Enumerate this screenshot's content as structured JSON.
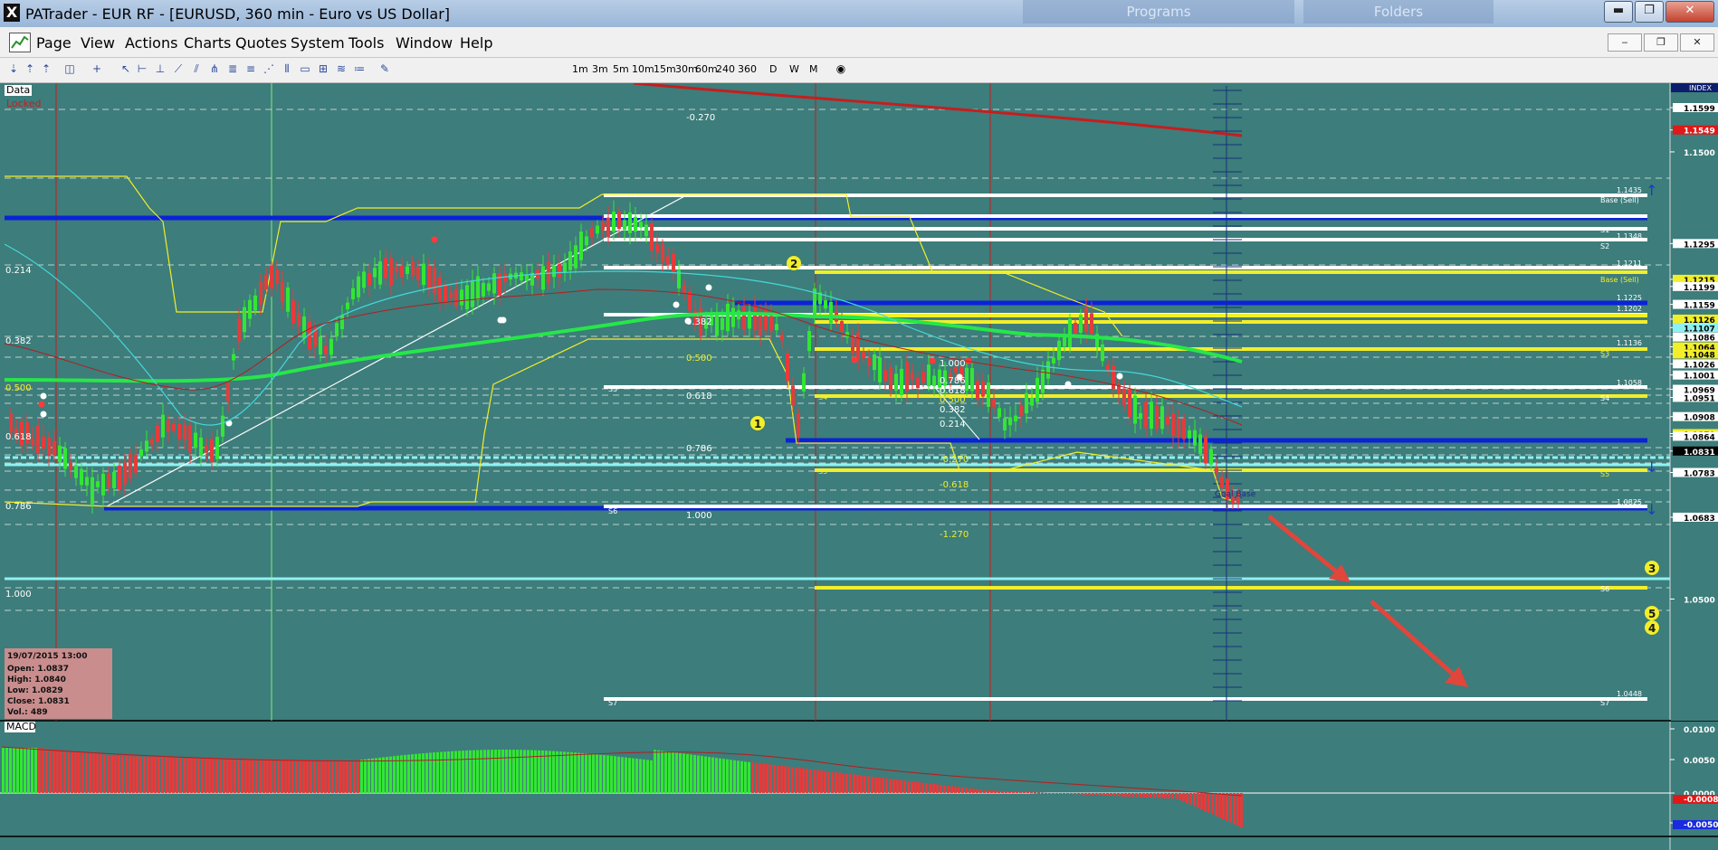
{
  "window": {
    "title": "PATrader - EUR RF - [EURUSD, 360 min - Euro vs US Dollar]",
    "app_icon": "X",
    "background_tabs": [
      "Programs",
      "Folders"
    ],
    "buttons": {
      "minimize": "▬",
      "maximize": "❐",
      "close": "✕"
    }
  },
  "menu": {
    "items": [
      "Page",
      "View",
      "Actions",
      "Charts",
      "Quotes",
      "System",
      "Tools",
      "Window",
      "Help"
    ],
    "mdi_buttons": [
      "‒",
      "❐",
      "✕"
    ]
  },
  "toolbar": {
    "timeframes": [
      "1m",
      "3m",
      "5m",
      "10m",
      "15m",
      "30m",
      "60m",
      "240",
      "360",
      "D",
      "W",
      "M"
    ]
  },
  "chart": {
    "label_data": "Data",
    "label_locked": "Locked",
    "index_label": "INDEX",
    "price_axis": [
      {
        "v": 1.1599,
        "box": "white"
      },
      {
        "v": 1.1549,
        "box": "red"
      },
      {
        "v": 1.15,
        "box": "none"
      },
      {
        "v": 1.1295,
        "box": "white"
      },
      {
        "v": 1.1215,
        "box": "yellow"
      },
      {
        "v": 1.1199,
        "box": "white"
      },
      {
        "v": 1.1159,
        "box": "white"
      },
      {
        "v": 1.1126,
        "box": "yellow"
      },
      {
        "v": 1.1107,
        "box": "cyan"
      },
      {
        "v": 1.1086,
        "box": "white"
      },
      {
        "v": 1.1064,
        "box": "yellow"
      },
      {
        "v": 1.1048,
        "box": "yellow"
      },
      {
        "v": 1.1026,
        "box": "white"
      },
      {
        "v": 1.1001,
        "box": "white"
      },
      {
        "v": 1.0969,
        "box": "white"
      },
      {
        "v": 1.0951,
        "box": "white"
      },
      {
        "v": 1.0908,
        "box": "white"
      },
      {
        "v": 1.087,
        "box": "yellow"
      },
      {
        "v": 1.0864,
        "box": "white"
      },
      {
        "v": 1.0831,
        "box": "black"
      },
      {
        "v": 1.0783,
        "box": "white"
      },
      {
        "v": 1.0683,
        "box": "white"
      },
      {
        "v": 1.05,
        "box": "none"
      }
    ],
    "fib_labels_left": [
      "0.214",
      "0.382",
      "0.500",
      "0.618",
      "0.786",
      "1.000"
    ],
    "fib_labels_mid": [
      "-0.270",
      "0.382",
      "0.500",
      "0.618",
      "0.786",
      "1.000"
    ],
    "fib_labels_right": [
      "1.000",
      "0.786",
      "0.618",
      "0.500",
      "0.382",
      "0.214",
      "-0.270",
      "-0.618",
      "-1.270"
    ],
    "level_tags": [
      "Base (Sell)",
      "S1",
      "S2",
      "Base (Sell)",
      "S3",
      "S4",
      "S5",
      "S6",
      "S7"
    ],
    "right_level_prices": [
      "1.1435",
      "1.1348",
      "1.1211",
      "1.1225",
      "1.1202",
      "1.1136",
      "1.1058",
      "1.0825",
      "1.0448"
    ],
    "mid_tags": [
      "S3",
      "S4",
      "S5",
      "S6",
      "S7"
    ],
    "circle_markers": [
      "1",
      "2",
      "3",
      "5",
      "4"
    ],
    "goal_base": "Goal Base",
    "info_box": {
      "date": "19/07/2015 13:00",
      "open": "Open: 1.0837",
      "high": "High: 1.0840",
      "low": "Low: 1.0829",
      "close": "Close: 1.0831",
      "vol": "Vol.: 489"
    }
  },
  "macd": {
    "label": "MACD",
    "axis": [
      "0.0100",
      "0.0050",
      "0.0000",
      "-0.0050"
    ],
    "value_red": "-0.0008",
    "value_blue": "-0.0050"
  },
  "colors": {
    "chart_bg": "#3d7d7b",
    "bull": "#33e633",
    "bear": "#e63b3b",
    "support_blue": "#0a22d8",
    "fib_yellow": "#f2ee2a",
    "cyan": "#8ef1f1",
    "ma_red": "#c71d1d",
    "ma_green": "#27e64a"
  }
}
